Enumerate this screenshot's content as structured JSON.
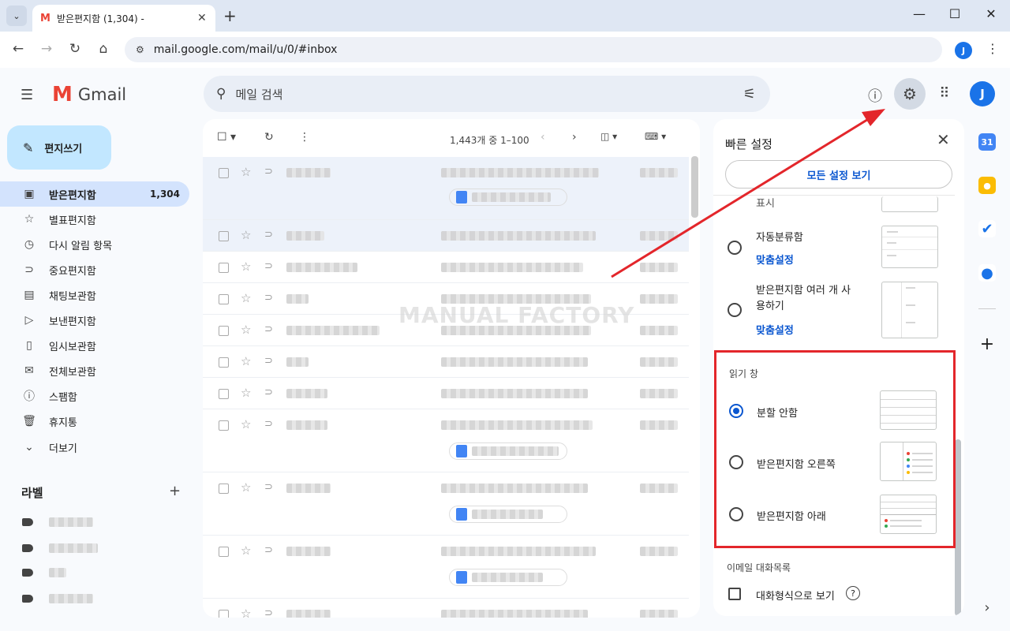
{
  "browser": {
    "tab_title": "받은편지함 (1,304) -",
    "url": "mail.google.com/mail/u/0/#inbox",
    "profile_initial": "J"
  },
  "header": {
    "app_name": "Gmail",
    "search_placeholder": "메일 검색",
    "avatar_initial": "J"
  },
  "compose": {
    "label": "편지쓰기"
  },
  "nav": [
    {
      "label": "받은편지함",
      "count": "1,304",
      "icon": "inbox-icon"
    },
    {
      "label": "별표편지함",
      "icon": "star-icon"
    },
    {
      "label": "다시 알림 항목",
      "icon": "clock-icon"
    },
    {
      "label": "중요편지함",
      "icon": "important-icon"
    },
    {
      "label": "채팅보관함",
      "icon": "chat-icon"
    },
    {
      "label": "보낸편지함",
      "icon": "send-icon"
    },
    {
      "label": "임시보관함",
      "icon": "draft-icon"
    },
    {
      "label": "전체보관함",
      "icon": "mail-icon"
    },
    {
      "label": "스팸함",
      "icon": "spam-icon"
    },
    {
      "label": "휴지통",
      "icon": "trash-icon"
    },
    {
      "label": "더보기",
      "icon": "chevron-down-icon"
    }
  ],
  "labels": {
    "title": "라벨"
  },
  "list": {
    "pager": "1,443개 중 1–100"
  },
  "watermark": "MANUAL FACTORY",
  "quick_settings": {
    "title": "빠른 설정",
    "all_settings": "모든 설정 보기",
    "partial_label": "표시",
    "inbox_types": [
      {
        "label": "자동분류함",
        "customize": "맞춤설정"
      },
      {
        "label": "받은편지함 여러 개 사용하기",
        "customize": "맞춤설정"
      }
    ],
    "reading_pane": {
      "title": "읽기 창",
      "options": [
        {
          "label": "분할 안함",
          "selected": true
        },
        {
          "label": "받은편지함 오른쪽",
          "selected": false
        },
        {
          "label": "받은편지함 아래",
          "selected": false
        }
      ]
    },
    "threading": {
      "title": "이메일 대화목록",
      "option": "대화형식으로 보기"
    }
  },
  "colors": {
    "accent": "#0b57d0",
    "highlight": "#e3262b",
    "compose_bg": "#c2e7ff",
    "nav_active": "#d3e3fd"
  }
}
